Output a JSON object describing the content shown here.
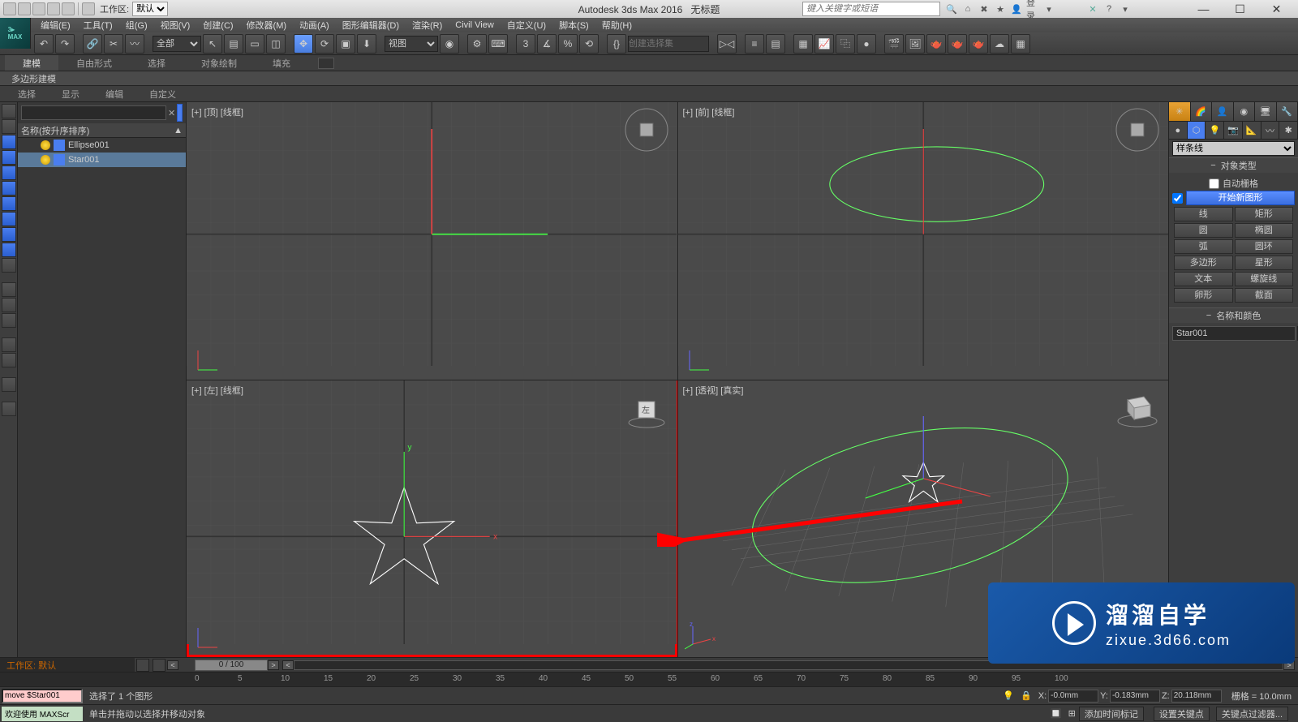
{
  "title": {
    "app": "Autodesk 3ds Max 2016",
    "doc": "无标题"
  },
  "workspace": {
    "label": "工作区:",
    "current": "默认"
  },
  "search": {
    "placeholder": "键入关键字或短语"
  },
  "login": {
    "label": "登录"
  },
  "menubar": [
    "编辑(E)",
    "工具(T)",
    "组(G)",
    "视图(V)",
    "创建(C)",
    "修改器(M)",
    "动画(A)",
    "图形编辑器(D)",
    "渲染(R)",
    "Civil View",
    "自定义(U)",
    "脚本(S)",
    "帮助(H)"
  ],
  "toolbar": {
    "filter": "全部",
    "coord": "视图",
    "selset_placeholder": "创建选择集"
  },
  "ribbon": {
    "tabs": [
      "建模",
      "自由形式",
      "选择",
      "对象绘制",
      "填充"
    ],
    "sub": "多边形建模",
    "panels": [
      "选择",
      "显示",
      "编辑",
      "自定义"
    ]
  },
  "scene_explorer": {
    "sort_header": "名称(按升序排序)",
    "items": [
      {
        "name": "Ellipse001",
        "selected": false
      },
      {
        "name": "Star001",
        "selected": true
      }
    ]
  },
  "viewports": {
    "tl": "[+] [顶] [线框]",
    "tr": "[+] [前] [线框]",
    "bl": "[+] [左] [线框]",
    "br": "[+] [透视] [真实]",
    "left_cube": "左"
  },
  "command_panel": {
    "category": "样条线",
    "rollouts": {
      "object_type": "对象类型",
      "auto_grid": "自动栅格",
      "start_new": "开始新图形",
      "buttons": [
        [
          "线",
          "矩形"
        ],
        [
          "圆",
          "椭圆"
        ],
        [
          "弧",
          "圆环"
        ],
        [
          "多边形",
          "星形"
        ],
        [
          "文本",
          "螺旋线"
        ],
        [
          "卵形",
          "截面"
        ]
      ],
      "name_color": "名称和颜色",
      "object_name": "Star001"
    }
  },
  "timeslider": {
    "workspace_label": "工作区: 默认",
    "handle": "0 / 100",
    "ticks": [
      0,
      5,
      10,
      15,
      20,
      25,
      30,
      35,
      40,
      45,
      50,
      55,
      60,
      65,
      70,
      75,
      80,
      85,
      90,
      95,
      100
    ]
  },
  "status": {
    "script": "move $Star001",
    "prompt": "选择了 1 个图形",
    "x": "-0.0mm",
    "y": "-0.183mm",
    "z": "20.118mm",
    "grid": "栅格 = 10.0mm"
  },
  "status2": {
    "welcome": "欢迎使用 MAXScr",
    "hint": "单击并拖动以选择并移动对象",
    "add_time_tag": "添加时间标记",
    "set_key": "设置关键点",
    "key_filters": "关键点过滤器..."
  },
  "watermark": {
    "line1": "溜溜自学",
    "line2": "zixue.3d66.com"
  }
}
